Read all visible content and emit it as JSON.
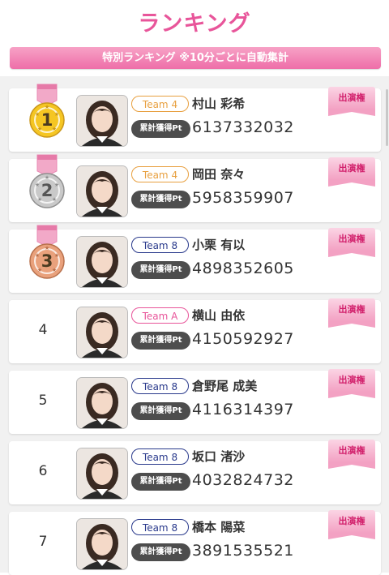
{
  "header": {
    "title": "ランキング"
  },
  "banner": {
    "text": "特別ランキング ※10分ごとに自動集計"
  },
  "labels": {
    "pt_badge": "累計獲得Pt",
    "appear_button": "出演権"
  },
  "colors": {
    "accent": "#e8559a",
    "team4": "#e8a040",
    "team8": "#2a3a8c",
    "teamA": "#e8559a",
    "gold": "#f5c623",
    "silver": "#c9c9c9",
    "bronze": "#e9a17c"
  },
  "rankings": [
    {
      "rank": "1",
      "medal": "gold",
      "team": "Team 4",
      "team_key": "team4",
      "name": "村山 彩希",
      "points": "6137332032"
    },
    {
      "rank": "2",
      "medal": "silver",
      "team": "Team 4",
      "team_key": "team4",
      "name": "岡田 奈々",
      "points": "5958359907"
    },
    {
      "rank": "3",
      "medal": "bronze",
      "team": "Team 8",
      "team_key": "team8",
      "name": "小栗 有以",
      "points": "4898352605"
    },
    {
      "rank": "4",
      "medal": "",
      "team": "Team A",
      "team_key": "teamA",
      "name": "横山 由依",
      "points": "4150592927"
    },
    {
      "rank": "5",
      "medal": "",
      "team": "Team 8",
      "team_key": "team8",
      "name": "倉野尾 成美",
      "points": "4116314397"
    },
    {
      "rank": "6",
      "medal": "",
      "team": "Team 8",
      "team_key": "team8",
      "name": "坂口 渚沙",
      "points": "4032824732"
    },
    {
      "rank": "7",
      "medal": "",
      "team": "Team 8",
      "team_key": "team8",
      "name": "橋本 陽菜",
      "points": "3891535521"
    }
  ]
}
